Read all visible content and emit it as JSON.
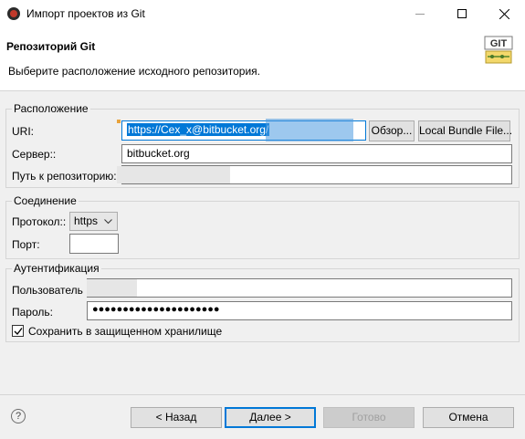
{
  "window": {
    "title": "Импорт проектов из Git",
    "icon": "eclipse-app-icon"
  },
  "header": {
    "title": "Репозиторий Git",
    "description": "Выберите расположение исходного репозитория.",
    "logo_text": "GIT"
  },
  "location": {
    "group_title": "Расположение",
    "uri_label": "URI:",
    "uri_value": "https://Cex_x@bitbucket.org/",
    "browse_button": "Обзор...",
    "local_bundle_button": "Local Bundle File...",
    "host_label": "Сервер::",
    "host_value": "bitbucket.org",
    "repo_path_label": "Путь к репозиторию:",
    "repo_path_value": ""
  },
  "connection": {
    "group_title": "Соединение",
    "protocol_label": "Протокол::",
    "protocol_value": "https",
    "port_label": "Порт:",
    "port_value": ""
  },
  "auth": {
    "group_title": "Аутентификация",
    "user_label": "Пользователь",
    "user_value": "",
    "password_label": "Пароль:",
    "password_value": "●●●●●●●●●●●●●●●●●●●●●",
    "store_checkbox_label": "Сохранить в защищенном хранилище",
    "store_checked": true
  },
  "footer": {
    "help_icon": "?",
    "back_button": "< Назад",
    "next_button": "Далее >",
    "finish_button": "Готово",
    "cancel_button": "Отмена"
  },
  "colors": {
    "accent": "#0078d7",
    "dialog_bg": "#f0f0f0"
  }
}
